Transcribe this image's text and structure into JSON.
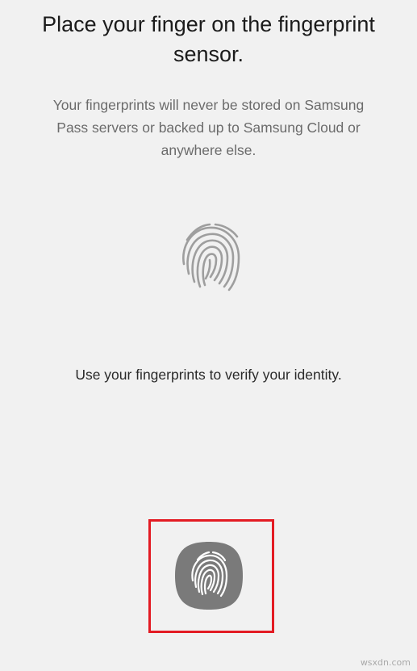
{
  "title": "Place your finger on the fingerprint\nsensor.",
  "subtitle": "Your fingerprints will never be stored on Samsung\nPass servers or backed up to Samsung Cloud or\nanywhere else.",
  "instruction": "Use your fingerprints to verify your identity.",
  "icons": {
    "illustration": "fingerprint-icon",
    "button": "fingerprint-icon"
  },
  "colors": {
    "background": "#f1f1f1",
    "highlight": "#e31b23",
    "button_fill": "#7a7a7a",
    "illustration_stroke": "#9e9e9e"
  },
  "watermark": "wsxdn.com"
}
